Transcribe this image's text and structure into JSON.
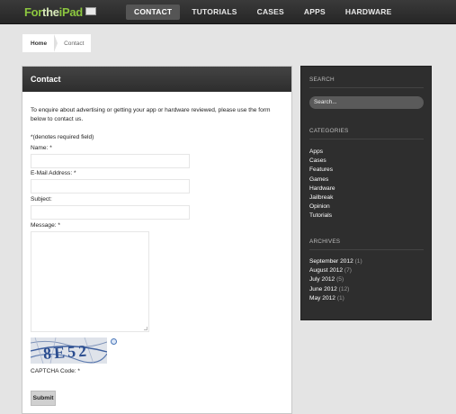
{
  "header": {
    "logo_part1": "For",
    "logo_part2": "the",
    "logo_part3": "iPad",
    "nav": [
      "CONTACT",
      "TUTORIALS",
      "CASES",
      "APPS",
      "HARDWARE"
    ]
  },
  "breadcrumb": {
    "home": "Home",
    "current": "Contact"
  },
  "content": {
    "title": "Contact",
    "intro": "To enquire about advertising or getting your app or hardware reviewed, please use the form below to contact us.",
    "required_note": "*(denotes required field)",
    "fields": {
      "name_label": "Name: *",
      "email_label": "E-Mail Address: *",
      "subject_label": "Subject:",
      "message_label": "Message: *",
      "captcha_label": "CAPTCHA Code: *"
    },
    "captcha_text": "8E52",
    "submit_label": "Submit"
  },
  "sidebar": {
    "search_title": "SEARCH",
    "search_placeholder": "Search...",
    "categories_title": "CATEGORIES",
    "categories": [
      "Apps",
      "Cases",
      "Features",
      "Games",
      "Hardware",
      "Jailbreak",
      "Opinion",
      "Tutorials"
    ],
    "archives_title": "ARCHIVES",
    "archives": [
      {
        "month": "September 2012",
        "count": "(1)"
      },
      {
        "month": "August 2012",
        "count": "(7)"
      },
      {
        "month": "July 2012",
        "count": "(5)"
      },
      {
        "month": "June 2012",
        "count": "(12)"
      },
      {
        "month": "May 2012",
        "count": "(1)"
      }
    ]
  },
  "colors": {
    "logo_green": "#8cc63f",
    "topbar": "#2f2f2f",
    "sidebar": "#2e2e2e"
  }
}
